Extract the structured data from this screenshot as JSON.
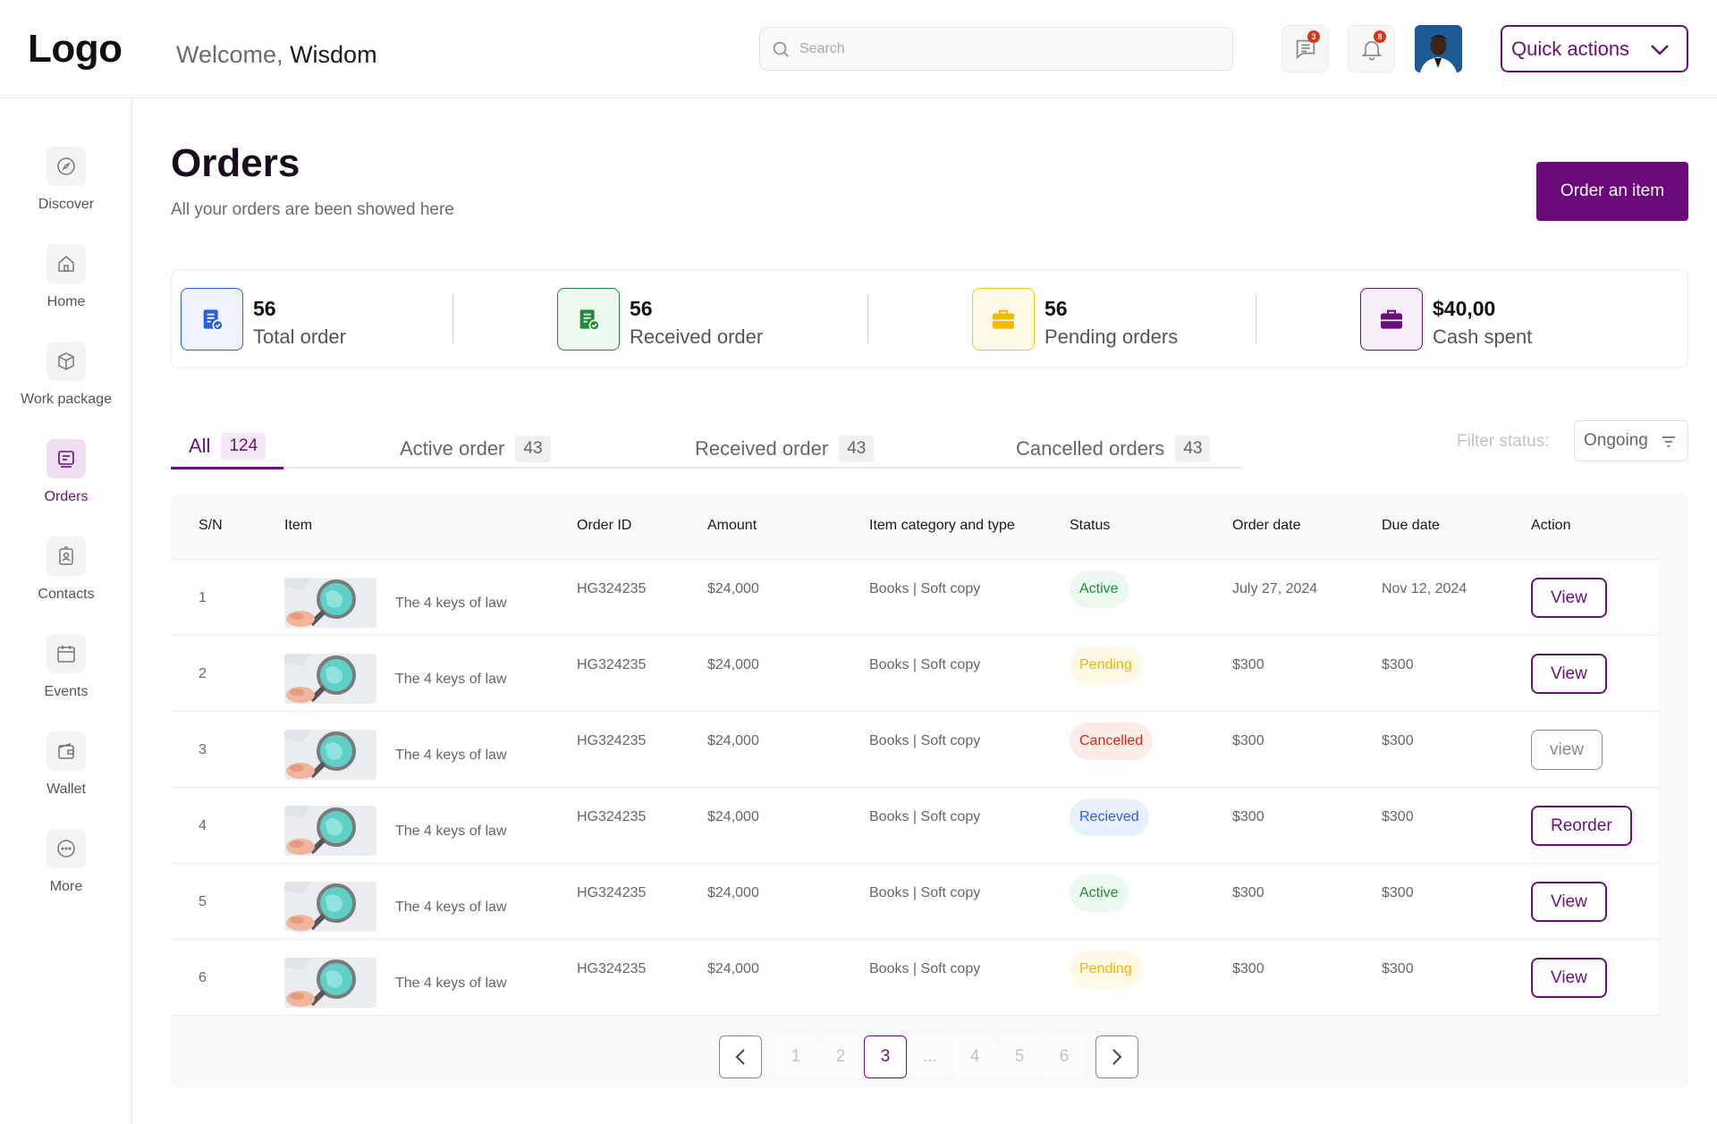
{
  "header": {
    "logo": "Logo",
    "welcome_prefix": "Welcome,",
    "user_name": "Wisdom",
    "search_placeholder": "Search",
    "messages_badge": "3",
    "notifications_badge": "8",
    "quick_actions_label": "Quick actions"
  },
  "sidebar": {
    "items": [
      {
        "label": "Discover",
        "icon": "compass-icon"
      },
      {
        "label": "Home",
        "icon": "home-icon"
      },
      {
        "label": "Work package",
        "icon": "package-icon"
      },
      {
        "label": "Orders",
        "icon": "orders-icon",
        "active": true
      },
      {
        "label": "Contacts",
        "icon": "contact-card-icon"
      },
      {
        "label": "Events",
        "icon": "calendar-icon"
      },
      {
        "label": "Wallet",
        "icon": "wallet-icon"
      },
      {
        "label": "More",
        "icon": "more-icon"
      }
    ]
  },
  "page": {
    "title": "Orders",
    "subtitle": "All your orders are been showed here",
    "order_button": "Order an item"
  },
  "stats": [
    {
      "value": "56",
      "label": "Total order",
      "color": "#2a5ee0"
    },
    {
      "value": "56",
      "label": "Received order",
      "color": "#1f8a3a"
    },
    {
      "value": "56",
      "label": "Pending orders",
      "color": "#f5c518"
    },
    {
      "value": "$40,00",
      "label": "Cash spent",
      "color": "#6a0f7c"
    }
  ],
  "tabs": [
    {
      "label": "All",
      "count": "124",
      "active": true
    },
    {
      "label": "Active order",
      "count": "43"
    },
    {
      "label": "Received order",
      "count": "43"
    },
    {
      "label": "Cancelled orders",
      "count": "43"
    }
  ],
  "filter": {
    "label": "Filter status:",
    "value": "Ongoing"
  },
  "table": {
    "headers": [
      "S/N",
      "Item",
      "Order ID",
      "Amount",
      "Item category and type",
      "Status",
      "Order date",
      "Due date",
      "Action"
    ],
    "rows": [
      {
        "sn": "1",
        "item": "The 4 keys of law",
        "order_id": "HG324235",
        "amount": "$24,000",
        "category": "Books | Soft copy",
        "status": "Active",
        "status_type": "active",
        "order_date": "July 27, 2024",
        "due_date": "Nov 12, 2024",
        "action": "View"
      },
      {
        "sn": "2",
        "item": "The 4 keys of law",
        "order_id": "HG324235",
        "amount": "$24,000",
        "category": "Books | Soft copy",
        "status": "Pending",
        "status_type": "pending",
        "order_date": "$300",
        "due_date": "$300",
        "action": "View"
      },
      {
        "sn": "3",
        "item": "The 4 keys of law",
        "order_id": "HG324235",
        "amount": "$24,000",
        "category": "Books | Soft copy",
        "status": "Cancelled",
        "status_type": "cancelled",
        "order_date": "$300",
        "due_date": "$300",
        "action": "view"
      },
      {
        "sn": "4",
        "item": "The 4 keys of law",
        "order_id": "HG324235",
        "amount": "$24,000",
        "category": "Books | Soft copy",
        "status": "Recieved",
        "status_type": "received",
        "order_date": "$300",
        "due_date": "$300",
        "action": "Reorder"
      },
      {
        "sn": "5",
        "item": "The 4 keys of law",
        "order_id": "HG324235",
        "amount": "$24,000",
        "category": "Books | Soft copy",
        "status": "Active",
        "status_type": "active",
        "order_date": "$300",
        "due_date": "$300",
        "action": "View"
      },
      {
        "sn": "6",
        "item": "The 4 keys of law",
        "order_id": "HG324235",
        "amount": "$24,000",
        "category": "Books | Soft copy",
        "status": "Pending",
        "status_type": "pending",
        "order_date": "$300",
        "due_date": "$300",
        "action": "View"
      }
    ]
  },
  "pagination": {
    "pages": [
      "1",
      "2",
      "3",
      "...",
      "4",
      "5",
      "6"
    ],
    "current": "3"
  }
}
